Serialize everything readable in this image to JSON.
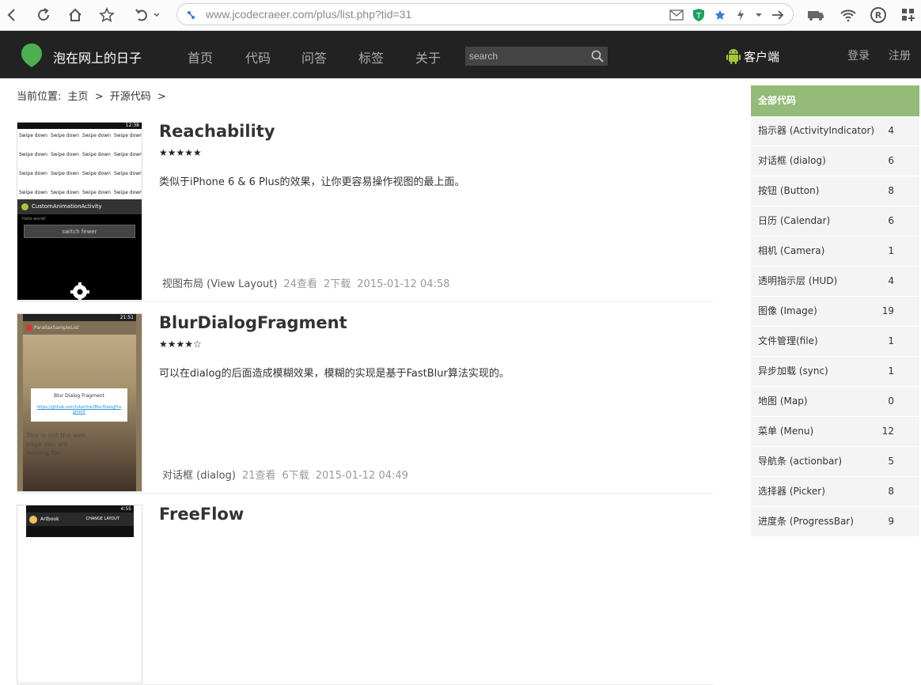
{
  "browser": {
    "url": "www.jcodecraeer.com/plus/list.php?tid=31"
  },
  "header": {
    "site_name": "泡在网上的日子",
    "menu": [
      "首页",
      "代码",
      "问答",
      "标签",
      "关于"
    ],
    "search_placeholder": "search",
    "client_label": "客户端",
    "login": "登录",
    "register": "注册"
  },
  "breadcrumb": {
    "prefix": "当前位置:",
    "items": [
      "主页",
      ">",
      "开源代码",
      ">"
    ]
  },
  "items": [
    {
      "title": "Reachability",
      "stars": "★★★★★",
      "description": "类似于iPhone 6 & 6 Plus的效果，让你更容易操作视图的最上面。",
      "category": "视图布局 (View Layout)",
      "views": "24查看",
      "downloads": "2下载",
      "date": "2015-01-12 04:58",
      "thumb": {
        "time": "12:38",
        "swipe": "Swipe down",
        "activity": "CustomAnimationActivity",
        "hint": "Hello world!",
        "button": "switch fewer"
      }
    },
    {
      "title": "BlurDialogFragment",
      "stars": "★★★★☆",
      "description": "可以在dialog的后面造成模糊效果，模糊的实现是基于FastBlur算法实现的。",
      "category": "对话框 (dialog)",
      "views": "21查看",
      "downloads": "6下载",
      "date": "2015-01-12 04:49",
      "thumb": {
        "time": "21:51",
        "app": "ParallaxSampleList",
        "dialog_title": "Blur Dialog Fragment",
        "dialog_link": "https://github.com/tvbarthel/BlurDialogFragment",
        "bg_text": "This is not the web page you are looking for."
      }
    },
    {
      "title": "FreeFlow",
      "thumb": {
        "time": "4:55",
        "app": "Artbook",
        "action": "CHANGE LAYOUT"
      }
    }
  ],
  "sidebar": {
    "title": "全部代码",
    "items": [
      {
        "label": "指示器 (ActivityIndicator)",
        "count": "4"
      },
      {
        "label": "对话框 (dialog)",
        "count": "6"
      },
      {
        "label": "按钮 (Button)",
        "count": "8"
      },
      {
        "label": "日历 (Calendar)",
        "count": "6"
      },
      {
        "label": "相机 (Camera)",
        "count": "1"
      },
      {
        "label": "透明指示层 (HUD)",
        "count": "4"
      },
      {
        "label": "图像 (Image)",
        "count": "19"
      },
      {
        "label": "文件管理(file)",
        "count": "1"
      },
      {
        "label": "异步加载 (sync)",
        "count": "1"
      },
      {
        "label": "地图 (Map)",
        "count": "0"
      },
      {
        "label": "菜单 (Menu)",
        "count": "12"
      },
      {
        "label": "导航条 (actionbar)",
        "count": "5"
      },
      {
        "label": "选择器 (Picker)",
        "count": "8"
      },
      {
        "label": "进度条 (ProgressBar)",
        "count": "9"
      }
    ]
  },
  "colors": {
    "header_bg": "#222222",
    "sidebar_head": "#94bb78",
    "logo_green": "#4caf50",
    "android_green": "#a4c639"
  }
}
